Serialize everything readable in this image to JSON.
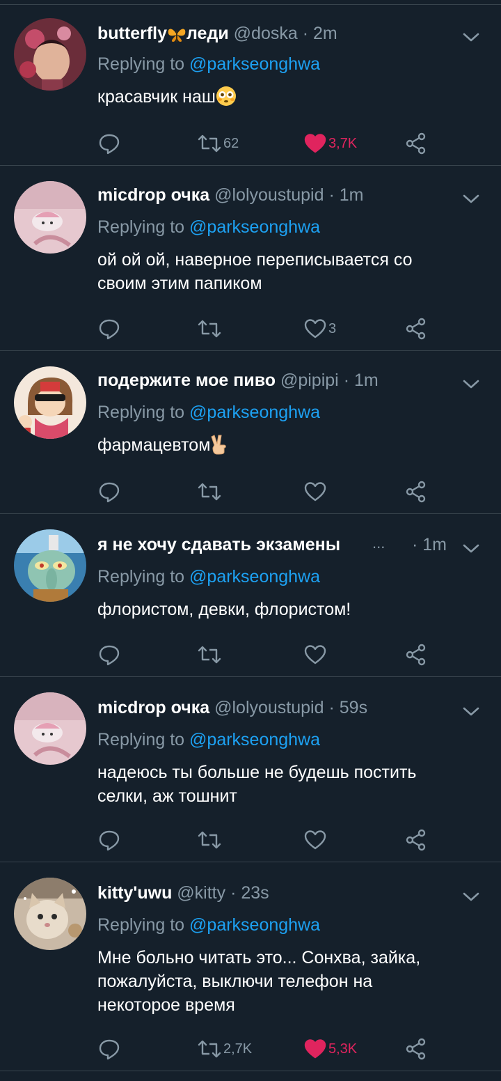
{
  "tweets": [
    {
      "name": "butterfly",
      "name_suffix": "леди",
      "handle": "@doska",
      "time": "2m",
      "reply_prefix": "Replying to",
      "reply_to": "@parkseonghwa",
      "text_lines": [
        "красавчик наш"
      ],
      "retweets": "62",
      "likes": "3,7K",
      "liked": true
    },
    {
      "name": "micdrop очка",
      "handle": "@lolyoustupid",
      "time": "1m",
      "reply_prefix": "Replying to",
      "reply_to": "@parkseonghwa",
      "text_lines": [
        "ой ой ой, наверное переписывается со",
        "своим этим папиком"
      ],
      "retweets": "",
      "likes": "3",
      "liked": false
    },
    {
      "name": "подержите мое пиво",
      "handle": "@pipipi",
      "time": "1m",
      "reply_prefix": "Replying to",
      "reply_to": "@parkseonghwa",
      "text_lines": [
        "фармацевтом"
      ],
      "retweets": "",
      "likes": "",
      "liked": false
    },
    {
      "name": "я не хочу сдавать экзамены",
      "handle": "...",
      "time": "1m",
      "reply_prefix": "Replying to",
      "reply_to": "@parkseonghwa",
      "text_lines": [
        "флористом, девки, флористом!"
      ],
      "retweets": "",
      "likes": "",
      "liked": false
    },
    {
      "name": "micdrop очка",
      "handle": "@lolyoustupid",
      "time": "59s",
      "reply_prefix": "Replying to",
      "reply_to": "@parkseonghwa",
      "text_lines": [
        "надеюсь ты больше не будешь постить",
        "селки, аж тошнит"
      ],
      "retweets": "",
      "likes": "",
      "liked": false
    },
    {
      "name": "kitty'uwu",
      "handle": "@kitty",
      "time": "23s",
      "reply_prefix": "Replying to",
      "reply_to": "@parkseonghwa",
      "text_lines": [
        "Мне больно читать это... Сонхва, зайка,",
        "пожалуйста, выключи телефон на",
        "некоторое время"
      ],
      "retweets": "2,7K",
      "likes": "5,3K",
      "liked": true
    }
  ],
  "icons": {
    "reply": "reply-icon",
    "retweet": "retweet-icon",
    "like": "heart-icon",
    "share": "share-icon",
    "more": "chevron-down-icon"
  },
  "colors": {
    "background": "#15202b",
    "divider": "#38444d",
    "secondary_text": "#8899a6",
    "mention": "#1da1f2",
    "like_active": "#e0245e"
  }
}
